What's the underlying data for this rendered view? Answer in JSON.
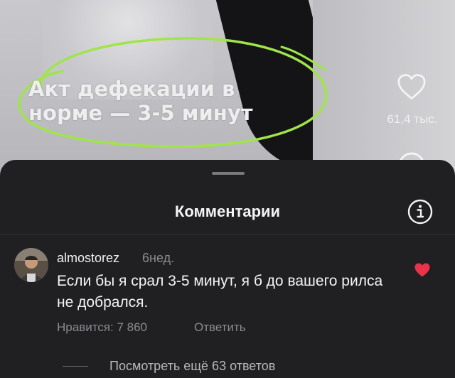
{
  "video": {
    "overlay_text": "Акт дефекации в\nнорме — 3-5 минут",
    "like_count": "61,4 тыс.",
    "highlight_color": "#9fe54a"
  },
  "comments_sheet": {
    "title": "Комментарии",
    "comment": {
      "username": "almostorez",
      "time": "6нед.",
      "text": "Если бы я срал 3-5 минут, я б до вашего рилса не добрался.",
      "likes": "Нравится: 7 860",
      "reply_label": "Ответить",
      "liked": true,
      "like_color": "#e8334a"
    },
    "more_replies": "Посмотреть ещё 63 ответов"
  }
}
